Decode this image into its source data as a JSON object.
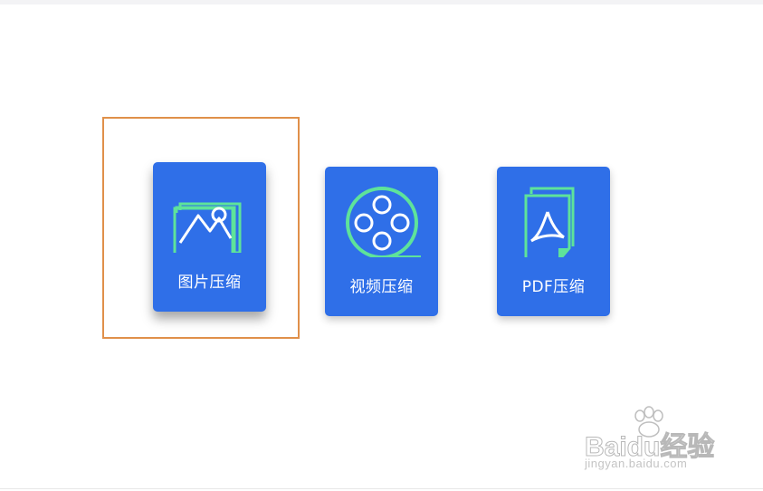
{
  "cards": [
    {
      "label": "图片压缩",
      "icon": "image-icon"
    },
    {
      "label": "视频压缩",
      "icon": "film-reel-icon"
    },
    {
      "label": "PDF压缩",
      "icon": "pdf-document-icon"
    }
  ],
  "watermark": {
    "logo_text": "Baidu经验",
    "url": "jingyan.baidu.com"
  },
  "colors": {
    "card_background": "#2f6fe8",
    "icon_accent": "#5ee39a",
    "selection_border": "#e0904a"
  }
}
